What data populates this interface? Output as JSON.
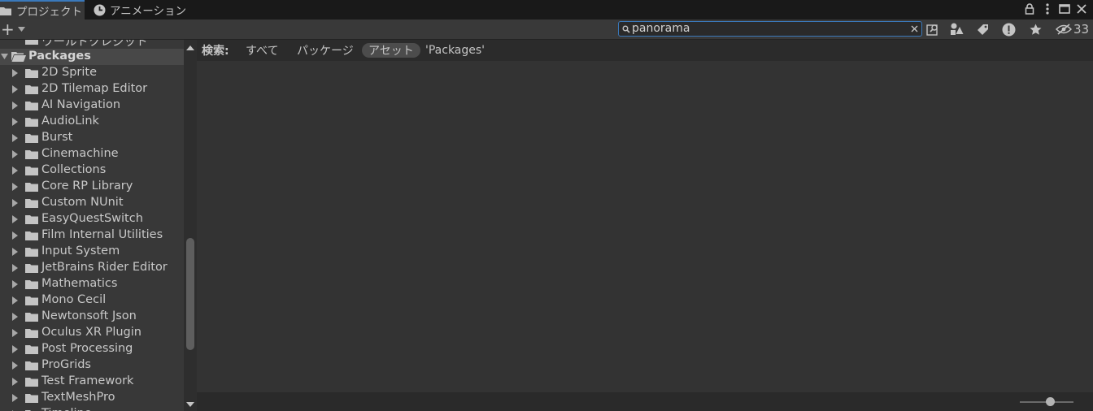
{
  "tabs": [
    {
      "label": "プロジェクト",
      "icon": "folder-icon"
    },
    {
      "label": "アニメーション",
      "icon": "clock-icon"
    }
  ],
  "toolbar": {
    "create_label": "+",
    "search_value": "panorama",
    "hidden_count": "33"
  },
  "tree": {
    "partial_top": "ワールドクレジット",
    "packages": "Packages",
    "items": [
      "2D Sprite",
      "2D Tilemap Editor",
      "AI Navigation",
      "AudioLink",
      "Burst",
      "Cinemachine",
      "Collections",
      "Core RP Library",
      "Custom NUnit",
      "EasyQuestSwitch",
      "Film Internal Utilities",
      "Input System",
      "JetBrains Rider Editor",
      "Mathematics",
      "Mono Cecil",
      "Newtonsoft Json",
      "Oculus XR Plugin",
      "Post Processing",
      "ProGrids",
      "Test Framework",
      "TextMeshPro",
      "Timeline"
    ]
  },
  "filter": {
    "search_label": "検索:",
    "all": "すべて",
    "packages": "パッケージ",
    "assets": "アセット",
    "scope": "'Packages'"
  },
  "colors": {
    "accent": "#3a79bb",
    "panel": "#383838",
    "content": "#333333"
  }
}
